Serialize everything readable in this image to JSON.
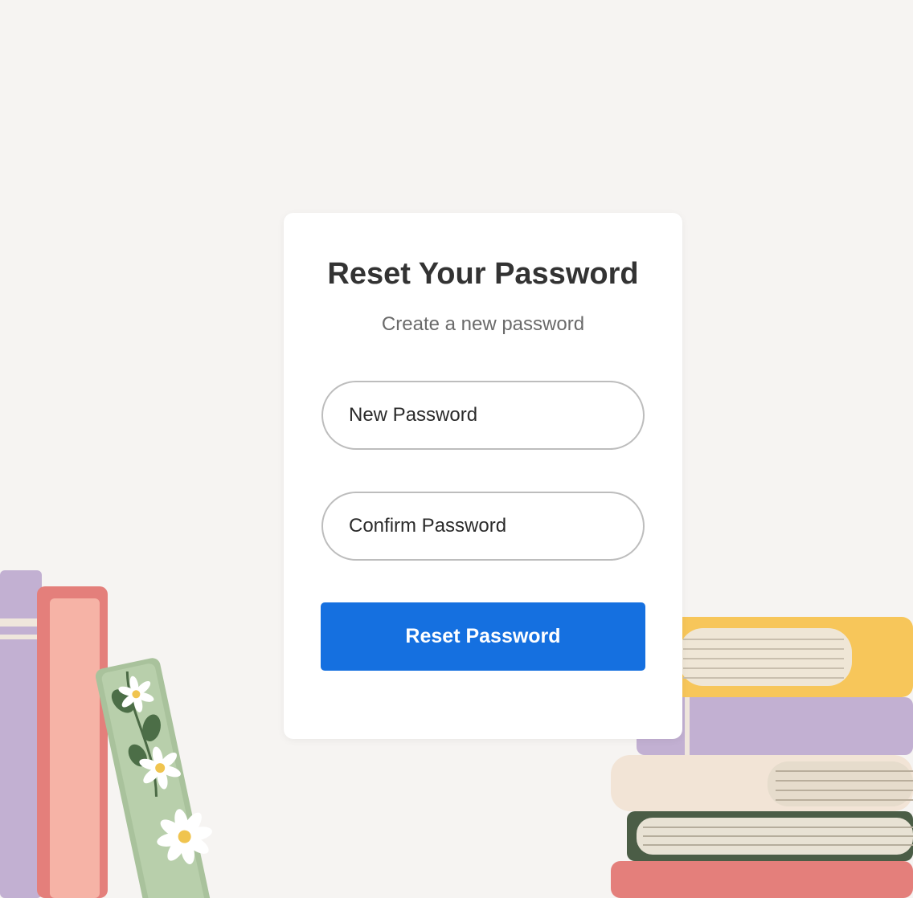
{
  "page": {
    "background_color": "#f6f4f2"
  },
  "reset_form": {
    "title": "Reset Your Password",
    "subtitle": "Create a new password",
    "new_password": {
      "placeholder": "New Password",
      "value": ""
    },
    "confirm_password": {
      "placeholder": "Confirm Password",
      "value": ""
    },
    "submit_label": "Reset Password",
    "accent_color": "#1570e0"
  },
  "decoration": {
    "illustration": "books-and-floral-bookmark",
    "colors": {
      "lavender": "#c2b0d2",
      "pink": "#f4a9a0",
      "red": "#e47f7b",
      "sage": "#a9c29c",
      "yellow": "#f7c65a",
      "cream": "#f2e4d6",
      "dark_green": "#4b5d46"
    }
  }
}
